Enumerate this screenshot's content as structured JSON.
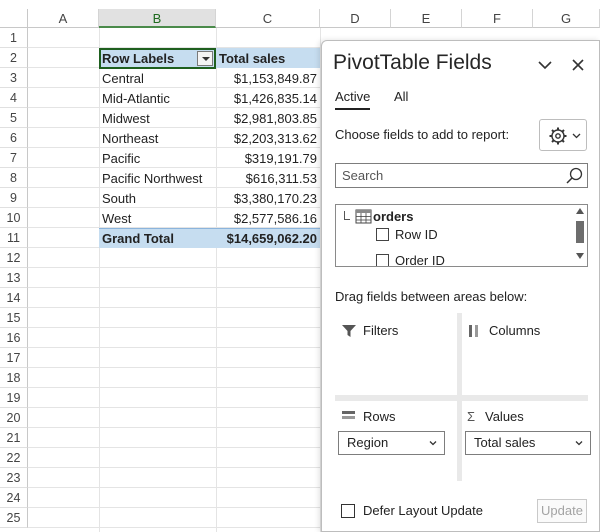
{
  "columns": [
    "A",
    "B",
    "C",
    "D",
    "E",
    "F",
    "G"
  ],
  "rows": [
    "1",
    "2",
    "3",
    "4",
    "5",
    "6",
    "7",
    "8",
    "9",
    "10",
    "11",
    "12",
    "13",
    "14",
    "15",
    "16",
    "17",
    "18",
    "19",
    "20",
    "21",
    "22",
    "23",
    "24",
    "25"
  ],
  "pivot": {
    "header_label": "Row Labels",
    "header_value": "Total sales",
    "data": [
      {
        "label": "Central",
        "value": "$1,153,849.87"
      },
      {
        "label": "Mid-Atlantic",
        "value": "$1,426,835.14"
      },
      {
        "label": "Midwest",
        "value": "$2,981,803.85"
      },
      {
        "label": "Northeast",
        "value": "$2,203,313.62"
      },
      {
        "label": "Pacific",
        "value": "$319,191.79"
      },
      {
        "label": "Pacific Northwest",
        "value": "$616,311.53"
      },
      {
        "label": "South",
        "value": "$3,380,170.23"
      },
      {
        "label": "West",
        "value": "$2,577,586.16"
      }
    ],
    "total_label": "Grand Total",
    "total_value": "$14,659,062.20"
  },
  "panel": {
    "title": "PivotTable Fields",
    "tabs": [
      "Active",
      "All"
    ],
    "choose_label": "Choose fields to add to report:",
    "search_placeholder": "Search",
    "table_name": "orders",
    "fields": [
      "Row ID",
      "Order ID"
    ],
    "drag_label": "Drag fields between areas below:",
    "areas": {
      "filters": "Filters",
      "columns": "Columns",
      "rows": "Rows",
      "values": "Values"
    },
    "rows_field": "Region",
    "values_field": "Total sales",
    "defer_label": "Defer Layout Update",
    "update_label": "Update"
  },
  "colors": {
    "pivot_header_bg": "#c6ddf0",
    "selection_border": "#1e5f1e"
  }
}
